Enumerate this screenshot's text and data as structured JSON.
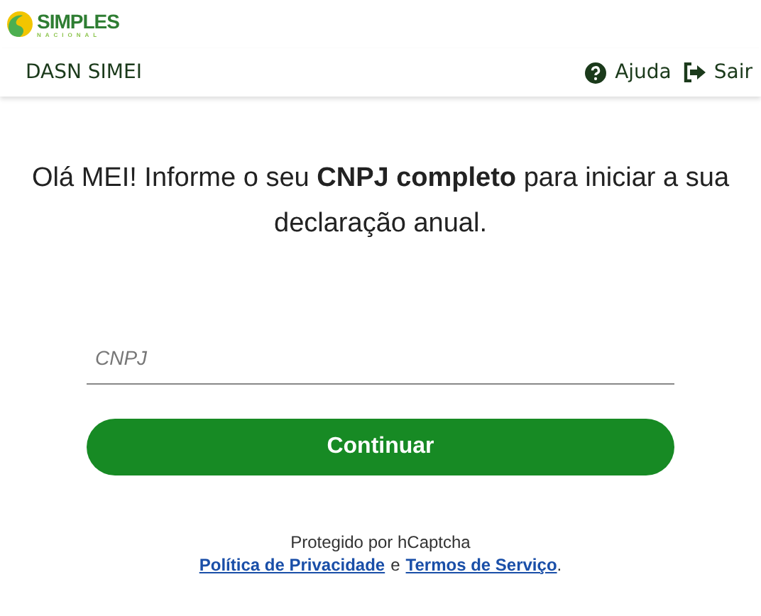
{
  "logo": {
    "title": "SIMPLES",
    "subtitle": "NACIONAL"
  },
  "navbar": {
    "title": "DASN SIMEI",
    "actions": [
      {
        "kind": "help",
        "label": "Ajuda"
      },
      {
        "kind": "exit",
        "label": "Sair"
      }
    ]
  },
  "form": {
    "heading": "Olá MEI! Informe o seu **CNPJ completo** para iniciar a sua declaração anual.",
    "cnpj": {
      "placeholder": "CNPJ"
    },
    "submit": "Continuar"
  },
  "captcha": {
    "text": "Protegido por hCaptcha",
    "links": [
      "Política de Privacidade",
      "Termos de Serviço"
    ],
    "joiner": "e",
    "end": "."
  }
}
